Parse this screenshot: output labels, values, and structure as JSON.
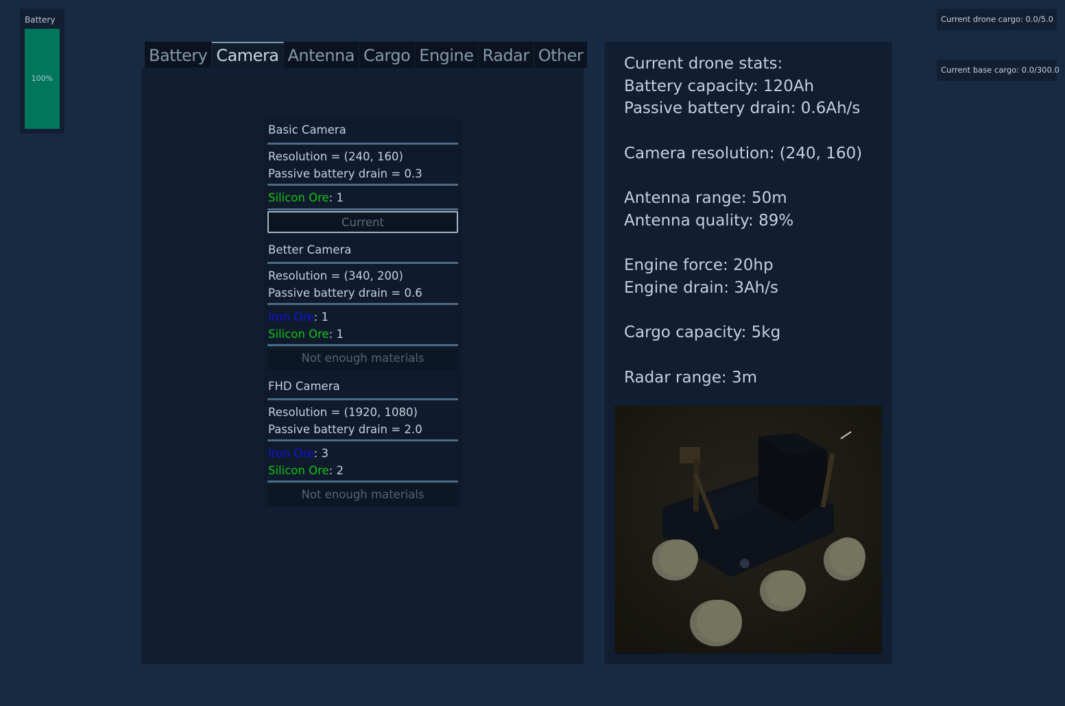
{
  "battery": {
    "label": "Battery",
    "percent_text": "100%",
    "level_fraction": 1.0,
    "fill_color": "#00765a"
  },
  "cargo": {
    "drone": "Current drone cargo: 0.0/5.0",
    "base": "Current base cargo: 0.0/300.0"
  },
  "tabs": [
    {
      "label": "Battery",
      "active": false
    },
    {
      "label": "Camera",
      "active": true
    },
    {
      "label": "Antenna",
      "active": false
    },
    {
      "label": "Cargo",
      "active": false
    },
    {
      "label": "Engine",
      "active": false
    },
    {
      "label": "Radar",
      "active": false
    },
    {
      "label": "Other",
      "active": false
    }
  ],
  "upgrades": [
    {
      "title": "Basic Camera",
      "resolution": "Resolution = (240, 160)",
      "drain": "Passive battery drain = 0.3",
      "costs": [
        {
          "ore": "Silicon Ore",
          "amount": ": 1",
          "color": "#14c414"
        }
      ],
      "button": "Current"
    },
    {
      "title": "Better Camera",
      "resolution": "Resolution = (340, 200)",
      "drain": "Passive battery drain = 0.6",
      "costs": [
        {
          "ore": "Iron Ore",
          "amount": ": 1",
          "color": "#0f14d8"
        },
        {
          "ore": "Silicon Ore",
          "amount": ": 1",
          "color": "#14c414"
        }
      ],
      "button": "Not enough materials"
    },
    {
      "title": "FHD Camera",
      "resolution": "Resolution = (1920, 1080)",
      "drain": "Passive battery drain = 2.0",
      "costs": [
        {
          "ore": "Iron Ore",
          "amount": ": 3",
          "color": "#0f14d8"
        },
        {
          "ore": "Silicon Ore",
          "amount": ": 2",
          "color": "#14c414"
        }
      ],
      "button": "Not enough materials"
    }
  ],
  "stats": {
    "lines": [
      "Current drone stats:",
      "Battery capacity: 120Ah",
      "Passive battery drain: 0.6Ah/s",
      "",
      "Camera resolution: (240, 160)",
      "",
      "Antenna range: 50m",
      "Antenna quality: 89%",
      "",
      "Engine force: 20hp",
      "Engine drain: 3Ah/s",
      "",
      "Cargo capacity: 5kg",
      "",
      "Radar range: 3m"
    ]
  },
  "preview": {
    "subject": "drone-rover-3d-preview"
  }
}
